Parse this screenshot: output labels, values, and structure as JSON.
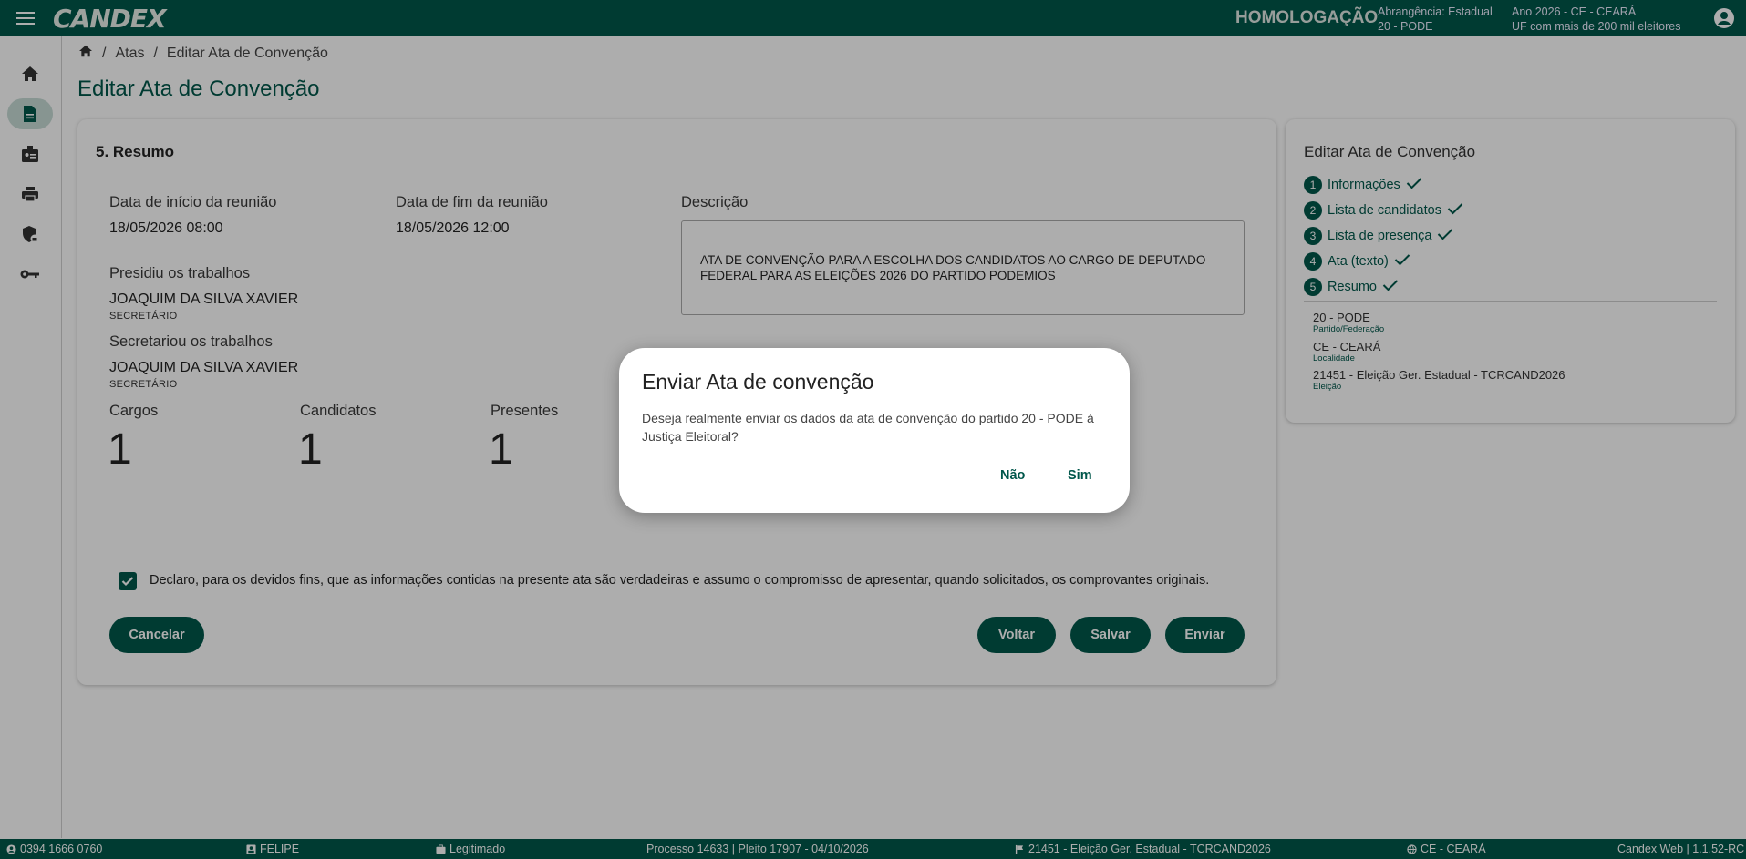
{
  "header": {
    "logo": "CANDEX",
    "environment": "HOMOLOGAÇÃO",
    "abrangencia_line1": "Abrangência: Estadual",
    "abrangencia_line2": "20 - PODE",
    "ano_line1": "Ano 2026 - CE - CEARÁ",
    "ano_line2": "UF com mais de 200 mil eleitores"
  },
  "sidenav": {
    "items": [
      "home-icon",
      "document-icon",
      "badge-icon",
      "print-icon",
      "shield-lock-icon",
      "key-icon"
    ],
    "active_index": 1
  },
  "breadcrumb": {
    "items": [
      "Atas",
      "Editar Ata de Convenção"
    ]
  },
  "page_title": "Editar Ata de Convenção",
  "resumo": {
    "section_title": "5. Resumo",
    "inicio_label": "Data de início da reunião",
    "inicio_value": "18/05/2026 08:00",
    "fim_label": "Data de fim da reunião",
    "fim_value": "18/05/2026 12:00",
    "descricao_label": "Descrição",
    "descricao_value": "ATA DE CONVENÇÃO PARA A ESCOLHA DOS CANDIDATOS AO CARGO DE DEPUTADO FEDERAL PARA AS ELEIÇÕES 2026 DO PARTIDO PODEMIOS",
    "presidiu_label": "Presidiu os trabalhos",
    "presidiu_name": "JOAQUIM DA SILVA XAVIER",
    "presidiu_role": "SECRETÁRIO",
    "secretariou_label": "Secretariou os trabalhos",
    "secretariou_name": "JOAQUIM DA SILVA XAVIER",
    "secretariou_role": "SECRETÁRIO",
    "cargos_label": "Cargos",
    "cargos_value": "1",
    "candidatos_label": "Candidatos",
    "candidatos_value": "1",
    "presentes_label": "Presentes",
    "presentes_value": "1",
    "declaration_checked": true,
    "declaration": "Declaro, para os devidos fins, que as informações contidas na presente ata são verdadeiras e assumo o compromisso de apresentar, quando solicitados, os comprovantes originais.",
    "cancel_label": "Cancelar",
    "back_label": "Voltar",
    "save_label": "Salvar",
    "send_label": "Enviar"
  },
  "side_panel": {
    "title": "Editar Ata de Convenção",
    "steps": [
      {
        "num": "1",
        "label": "Informações"
      },
      {
        "num": "2",
        "label": "Lista de candidatos"
      },
      {
        "num": "3",
        "label": "Lista de presença"
      },
      {
        "num": "4",
        "label": "Ata (texto)"
      },
      {
        "num": "5",
        "label": "Resumo"
      }
    ],
    "info": [
      {
        "value": "20 - PODE",
        "label": "Partido/Federação"
      },
      {
        "value": "CE - CEARÁ",
        "label": "Localidade"
      },
      {
        "value": "21451 - Eleição Ger. Estadual - TCRCAND2026",
        "label": "Eleição"
      }
    ]
  },
  "dialog": {
    "title": "Enviar Ata de convenção",
    "body": "Deseja realmente enviar os dados da ata de convenção do partido 20 - PODE à Justiça Eleitoral?",
    "no_label": "Não",
    "yes_label": "Sim"
  },
  "footer": {
    "cpf": "0394 1666 0760",
    "user": "FELIPE",
    "status": "Legitimado",
    "processo": "Processo 14633 | Pleito 17907 - 04/10/2026",
    "eleicao": "21451 - Eleição Ger. Estadual - TCRCAND2026",
    "uf": "CE - CEARÁ",
    "version": "Candex Web | 1.1.52-RC"
  },
  "colors": {
    "primary": "#00574b",
    "overlay": "rgba(0,0,0,0.32)"
  }
}
